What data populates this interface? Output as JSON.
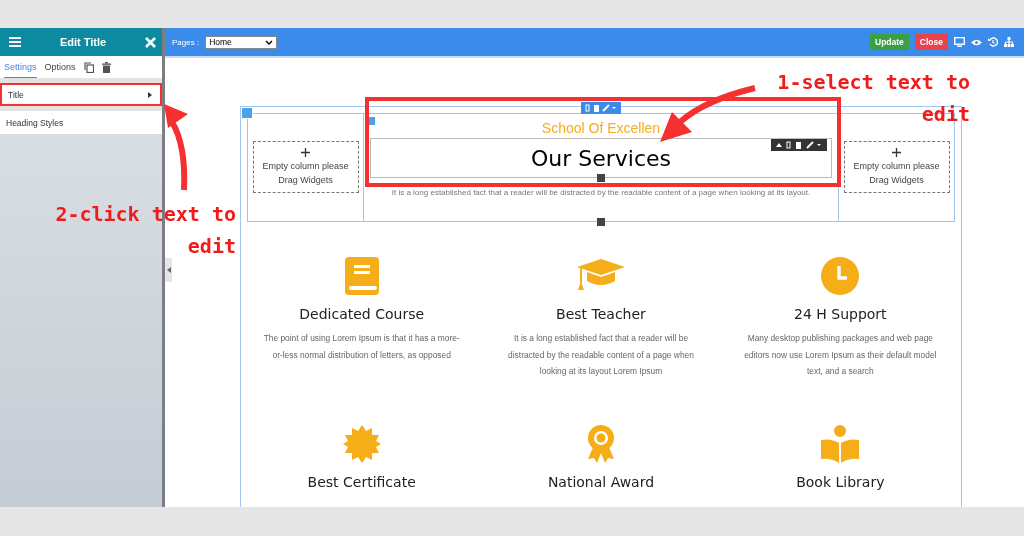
{
  "sidebar": {
    "title": "Edit Title",
    "tabs": [
      {
        "label": "Settings",
        "selected": true
      },
      {
        "label": "Options",
        "selected": false
      }
    ],
    "items": [
      {
        "label": "Title",
        "kind": "expandable",
        "highlighted": true
      },
      {
        "label": "Heading Styles",
        "kind": "plain",
        "highlighted": false
      }
    ]
  },
  "toolbar": {
    "pages_label": "Pages :",
    "page_select": "Home",
    "buttons": [
      {
        "label": "Update",
        "kind": "primary"
      },
      {
        "label": "Close",
        "kind": "danger"
      }
    ]
  },
  "canvas": {
    "empty_columns": [
      {
        "text": "Empty column please Drag Widgets"
      },
      {
        "text": "Empty column please Drag Widgets"
      }
    ],
    "subtitle": "School Of Excellen",
    "heading": "Our Services",
    "heading_highlighted": true,
    "intro": "It is a long established fact that a reader will be distracted by the readable content of a page when looking at its layout.",
    "features": [
      {
        "kind": "book",
        "title": "Dedicated Course",
        "text": "The point of using Lorem Ipsum is that it has a more-or-less normal distribution of letters, as opposed"
      },
      {
        "kind": "cap",
        "title": "Best Teacher",
        "text": "It is a long established fact that a reader will be distracted by the readable content of a page when looking at its layout Lorem Ipsum"
      },
      {
        "kind": "clock",
        "title": "24 H Support",
        "text": "Many desktop publishing packages and web page editors now use Lorem Ipsum as their default model text, and a search"
      },
      {
        "kind": "seal",
        "title": "Best Certificate"
      },
      {
        "kind": "award",
        "title": "National Award"
      },
      {
        "kind": "reader",
        "title": "Book Library"
      }
    ]
  },
  "annotations": [
    {
      "text": "1-select text to edit"
    },
    {
      "text": "2-click text to edit"
    }
  ]
}
